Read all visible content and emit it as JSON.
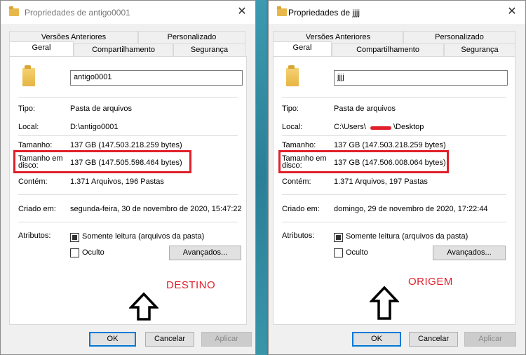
{
  "left": {
    "title": "Propriedades de antigo0001",
    "tabs": {
      "versoes": "Versões Anteriores",
      "personalizado": "Personalizado",
      "geral": "Geral",
      "compartilhamento": "Compartilhamento",
      "seguranca": "Segurança"
    },
    "name": "antigo0001",
    "fields": {
      "tipo_label": "Tipo:",
      "tipo_val": "Pasta de arquivos",
      "local_label": "Local:",
      "local_val": "D:\\antigo0001",
      "tamanho_label": "Tamanho:",
      "tamanho_val": "137 GB (147.503.218.259 bytes)",
      "disco_label_1": "Tamanho em",
      "disco_label_2": "disco:",
      "disco_val": "137 GB (147.505.598.464 bytes)",
      "contem_label": "Contém:",
      "contem_val": "1.371 Arquivos, 196 Pastas",
      "criado_label": "Criado em:",
      "criado_val": "segunda-feira, 30 de novembro de 2020, 15:47:22",
      "atributos_label": "Atributos:"
    },
    "attrs": {
      "somente_leitura": "Somente leitura (arquivos da pasta)",
      "oculto": "Oculto",
      "avancados": "Avançados..."
    },
    "annotation": "DESTINO",
    "buttons": {
      "ok": "OK",
      "cancel": "Cancelar",
      "apply": "Aplicar"
    }
  },
  "right": {
    "title": "Propriedades de jjjj",
    "tabs": {
      "versoes": "Versões Anteriores",
      "personalizado": "Personalizado",
      "geral": "Geral",
      "compartilhamento": "Compartilhamento",
      "seguranca": "Segurança"
    },
    "name": "jjjj",
    "fields": {
      "tipo_label": "Tipo:",
      "tipo_val": "Pasta de arquivos",
      "local_label": "Local:",
      "local_val_a": "C:\\Users\\",
      "local_val_b": "\\Desktop",
      "tamanho_label": "Tamanho:",
      "tamanho_val": "137 GB (147.503.218.259 bytes)",
      "disco_label_1": "Tamanho em",
      "disco_label_2": "disco:",
      "disco_val": "137 GB (147.506.008.064 bytes)",
      "contem_label": "Contém:",
      "contem_val": "1.371 Arquivos, 197 Pastas",
      "criado_label": "Criado em:",
      "criado_val": "domingo, 29 de novembro de 2020, 17:22:44",
      "atributos_label": "Atributos:"
    },
    "attrs": {
      "somente_leitura": "Somente leitura (arquivos da pasta)",
      "oculto": "Oculto",
      "avancados": "Avançados..."
    },
    "annotation": "ORIGEM",
    "buttons": {
      "ok": "OK",
      "cancel": "Cancelar",
      "apply": "Aplicar"
    }
  },
  "colors": {
    "annotation_red": "#e0202a",
    "default_button_border": "#0078d7"
  },
  "icons": [
    "folder-icon",
    "close-icon",
    "up-arrow-icon"
  ]
}
